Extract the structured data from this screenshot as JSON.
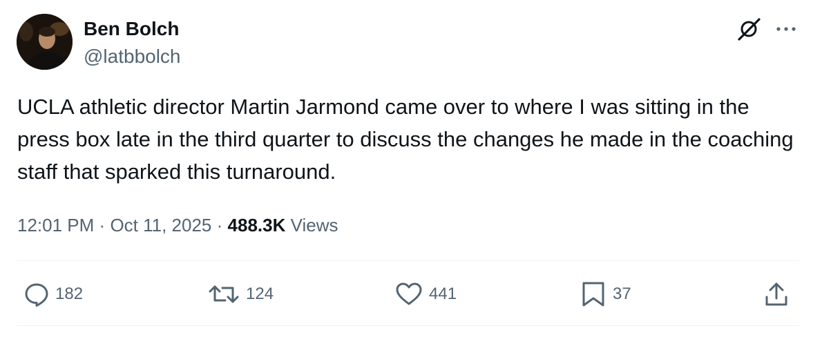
{
  "author": {
    "name": "Ben Bolch",
    "handle": "@latbbolch"
  },
  "tweet": {
    "text": "UCLA athletic director Martin Jarmond came over to where I was sitting in the press box late in the third quarter to discuss the changes he made in the coaching staff that sparked this turnaround."
  },
  "meta": {
    "time": "12:01 PM",
    "separator": "·",
    "date": "Oct 11, 2025",
    "views_count": "488.3K",
    "views_label": "Views"
  },
  "actions": {
    "reply_count": "182",
    "repost_count": "124",
    "like_count": "441",
    "bookmark_count": "37"
  },
  "icons": {
    "grok": "grok-icon",
    "more": "more-icon",
    "reply": "reply-icon",
    "repost": "repost-icon",
    "like": "like-icon",
    "bookmark": "bookmark-icon",
    "share": "share-icon"
  },
  "colors": {
    "text_primary": "#0f1419",
    "text_secondary": "#536471",
    "divider": "#eff3f4"
  }
}
